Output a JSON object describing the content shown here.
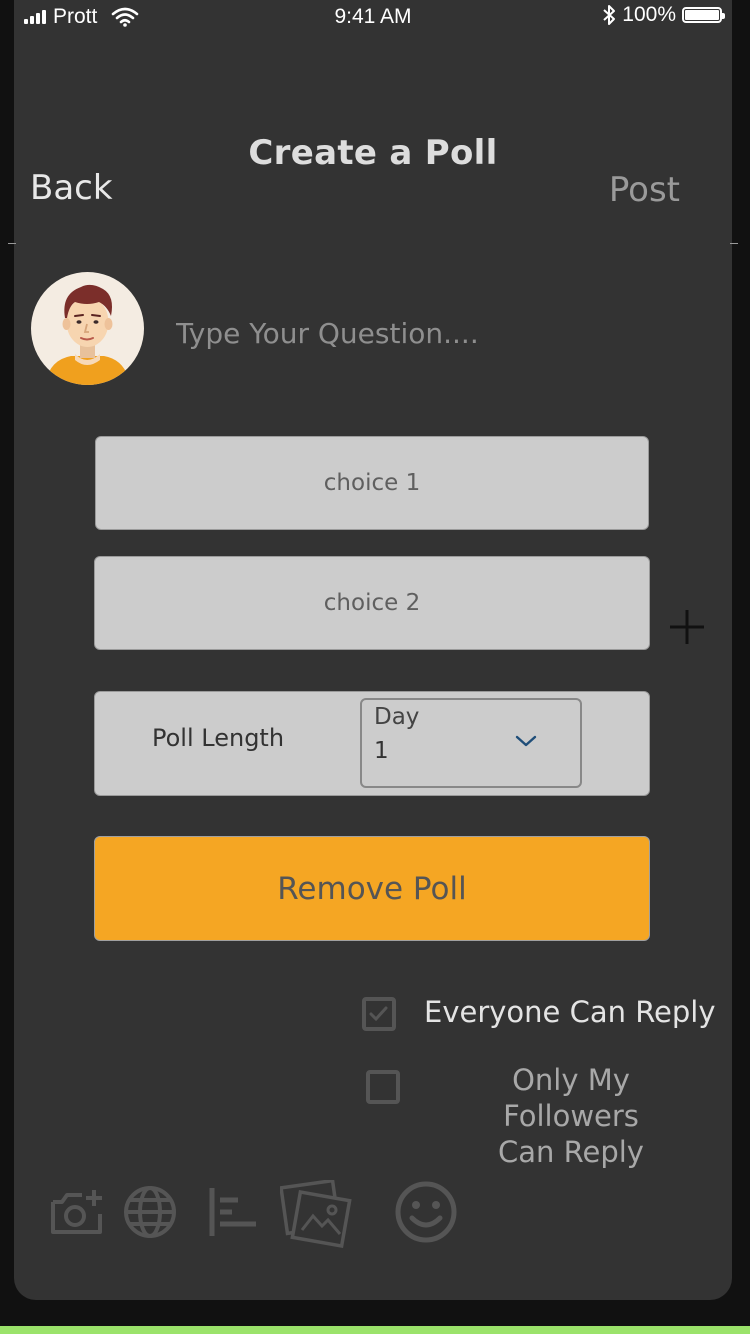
{
  "status_bar": {
    "carrier": "Prott",
    "time": "9:41 AM",
    "battery": "100%",
    "battery_level": 1.0
  },
  "header": {
    "title": "Create a Poll",
    "back_label": "Back",
    "post_label": "Post"
  },
  "composer": {
    "avatar": "user-avatar-icon",
    "question_placeholder": "Type Your Question...."
  },
  "choices": [
    {
      "placeholder": "choice 1"
    },
    {
      "placeholder": "choice 2"
    }
  ],
  "add_choice_icon": "plus-icon",
  "poll_length": {
    "label": "Poll Length",
    "unit_label": "Day",
    "value": "1"
  },
  "remove_poll_label": "Remove Poll",
  "reply_options": [
    {
      "label": "Everyone Can Reply",
      "checked": true
    },
    {
      "label": "Only My Followers Can Reply",
      "label_line1": "Only My Followers",
      "label_line2": "Can Reply",
      "checked": false
    }
  ],
  "toolbar": {
    "icons": [
      "add-photo-icon",
      "globe-icon",
      "poll-icon",
      "gallery-icon",
      "emoji-icon"
    ]
  },
  "colors": {
    "background": "#333333",
    "accent": "#f5a623",
    "field": "#cccccc",
    "icon": "#555555"
  }
}
